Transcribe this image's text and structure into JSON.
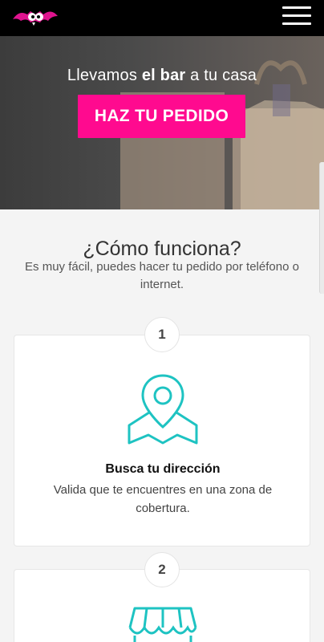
{
  "header": {
    "logo_icon": "bat-mascot-logo",
    "menu_icon": "hamburger-menu-icon"
  },
  "hero": {
    "tagline_pre": "Llevamos ",
    "tagline_bold": "el bar",
    "tagline_post": " a tu casa",
    "cta_label": "HAZ TU PEDIDO",
    "cta_color": "#ff0a8f"
  },
  "how": {
    "title": "¿Cómo funciona?",
    "subtitle": "Es muy fácil, puedes hacer tu pedido por teléfono o internet."
  },
  "steps": [
    {
      "number": "1",
      "icon": "map-pin-icon",
      "title": "Busca tu dirección",
      "description": "Valida que te encuentres en una zona de cobertura."
    },
    {
      "number": "2",
      "icon": "storefront-awning-icon"
    }
  ],
  "colors": {
    "accent": "#1ec3c2",
    "brand": "#ff0a8f"
  }
}
